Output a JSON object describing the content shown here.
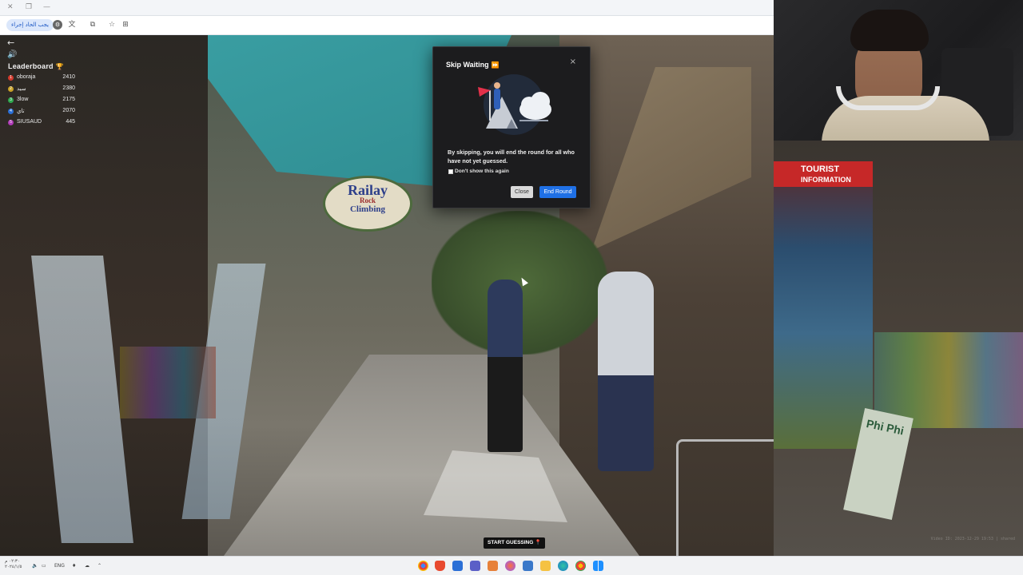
{
  "browser": {
    "extension_label": "يجب الحاد إجراء",
    "toolbar_icons": [
      "settings-icon",
      "translate-icon",
      "extensions-icon",
      "favorites-icon",
      "collections-icon"
    ]
  },
  "game": {
    "back_icon": "←",
    "volume_icon": "🔊",
    "leaderboard": {
      "title": "Leaderboard",
      "trophy": "🏆",
      "rows": [
        {
          "rank": "1",
          "name": "oboraja",
          "score": "2410",
          "color": "#d33a2c"
        },
        {
          "rank": "2",
          "name": "سيد",
          "score": "2380",
          "color": "#c9a227"
        },
        {
          "rank": "3",
          "name": "3low",
          "score": "2175",
          "color": "#2fa84f"
        },
        {
          "rank": "4",
          "name": "تاي",
          "score": "2070",
          "color": "#2a6fd6"
        },
        {
          "rank": "5",
          "name": "SIUSAUD",
          "score": "445",
          "color": "#b03ab8"
        }
      ]
    },
    "start_guessing": "START GUESSING",
    "pin_icon": "📍"
  },
  "modal": {
    "title": "Skip Waiting",
    "title_icon": "⏩",
    "close_icon": "×",
    "body": "By skipping, you will end the round for all who have not yet guessed.",
    "checkbox_label": "Don't show this again",
    "close_button": "Close",
    "end_round_button": "End Round"
  },
  "scene": {
    "sign_railay": "Railay",
    "sign_rock": "Rock",
    "sign_climbing": "Climbing",
    "sign_tourist": "TOURIST",
    "sign_information": "INFORMATION",
    "sign_phiphi": "Phi Phi"
  },
  "taskbar": {
    "lang": "ENG",
    "time_line1": "٠٢:٣٠ م",
    "time_line2": "٢٠٢٤/١/٥",
    "apps": [
      "chrome-icon",
      "brave-icon",
      "store-icon",
      "teams-icon",
      "office-icon",
      "firefox-icon",
      "app-icon",
      "files-icon",
      "edge-icon",
      "chrome-alt-icon",
      "windows-icon"
    ]
  },
  "watermark": "Video ID: 2023-12-29 19:53 | shared"
}
